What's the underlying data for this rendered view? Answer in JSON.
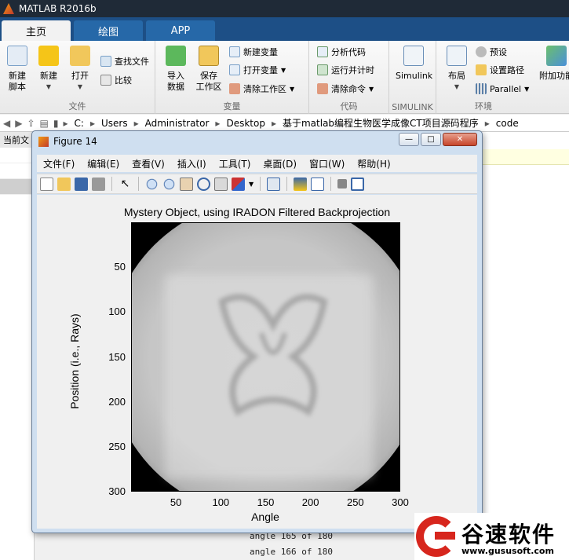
{
  "app": {
    "title": "MATLAB R2016b"
  },
  "tabs": [
    {
      "label": "主页"
    },
    {
      "label": "绘图"
    },
    {
      "label": "APP"
    }
  ],
  "ribbon": {
    "file": {
      "group": "文件",
      "new_script": "新建\n脚本",
      "new": "新建",
      "open": "打开",
      "find_files": "查找文件",
      "compare": "比较"
    },
    "variable": {
      "group": "变量",
      "import": "导入\n数据",
      "save_ws": "保存\n工作区",
      "new_var": "新建变量",
      "open_var": "打开变量",
      "clear_ws": "清除工作区"
    },
    "code": {
      "group": "代码",
      "analyze": "分析代码",
      "run_time": "运行并计时",
      "clear_cmd": "清除命令"
    },
    "simulink": {
      "group": "SIMULINK",
      "label": "Simulink"
    },
    "env": {
      "group": "环境",
      "layout": "布局",
      "prefs": "预设",
      "set_path": "设置路径",
      "parallel": "Parallel",
      "addons": "附加功能"
    }
  },
  "address": {
    "crumbs": [
      "C:",
      "Users",
      "Administrator",
      "Desktop",
      "基于matlab编程生物医学成像CT项目源码程序",
      "code"
    ]
  },
  "left_panel": {
    "header": "当前文"
  },
  "figure": {
    "title": "Figure 14",
    "menu": [
      "文件(F)",
      "编辑(E)",
      "查看(V)",
      "插入(I)",
      "工具(T)",
      "桌面(D)",
      "窗口(W)",
      "帮助(H)"
    ]
  },
  "chart_data": {
    "type": "heatmap",
    "title": "Mystery Object, using IRADON Filtered Backprojection",
    "xlabel": "Angle",
    "ylabel": "Position (i.e., Rays)",
    "x_ticks": [
      50,
      100,
      150,
      200,
      250,
      300
    ],
    "y_ticks": [
      50,
      100,
      150,
      200,
      250,
      300
    ],
    "xlim": [
      0,
      300
    ],
    "ylim": [
      0,
      300
    ],
    "colormap": "gray"
  },
  "command_window": {
    "lines": [
      "angle 165 of 180",
      "angle 166 of 180"
    ]
  },
  "watermark": {
    "brand": "谷速软件",
    "url": "www.gususoft.com"
  },
  "colors": {
    "title_bar": "#1f2a37",
    "tab_strip": "#1d4f86",
    "figure_frame": "#cfdff0"
  }
}
